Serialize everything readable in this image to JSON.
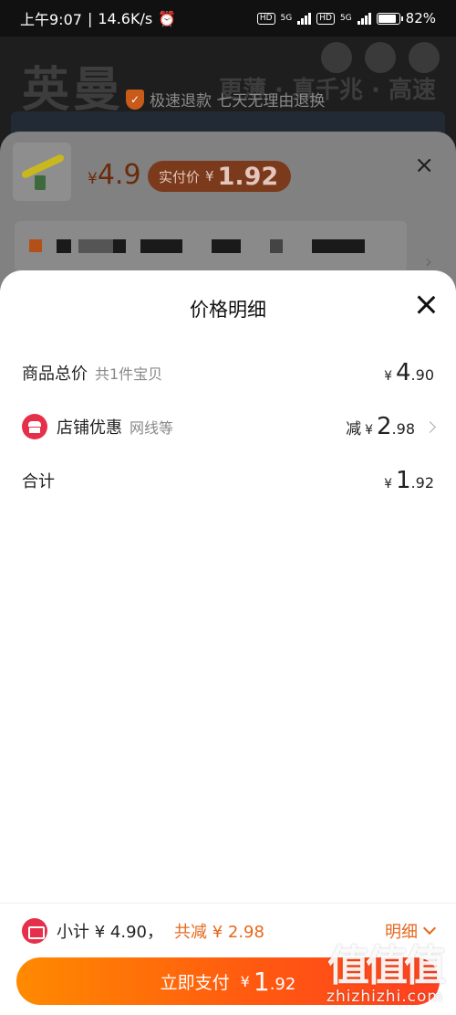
{
  "status_bar": {
    "time": "上午9:07",
    "speed": "14.6K/s",
    "network_1": "5G",
    "network_2": "5G",
    "battery": "82%"
  },
  "background": {
    "brand": "英曼",
    "slogan": "更薄 · 真千兆 · 高速",
    "refund_text": "极速退款 七天无理由退换"
  },
  "sku_panel": {
    "price_symbol": "¥",
    "price": "4.9",
    "actual_label": "实付价",
    "actual_symbol": "¥",
    "actual_price": "1.92",
    "close_icon": "×",
    "spec_text": "...(已打码)"
  },
  "price_detail": {
    "title": "价格明细",
    "rows": [
      {
        "label": "商品总价",
        "sub": "共1件宝贝",
        "prefix": "",
        "symbol": "¥",
        "integer": "4",
        "decimal": ".90"
      },
      {
        "label": "店铺优惠",
        "sub": "网线等",
        "prefix": "减",
        "symbol": "¥",
        "integer": "2",
        "decimal": ".98"
      },
      {
        "label": "合计",
        "sub": "",
        "prefix": "",
        "symbol": "¥",
        "integer": "1",
        "decimal": ".92"
      }
    ]
  },
  "bottom_bar": {
    "subtotal": "小计 ¥ 4.90，",
    "total_saved": "共减 ¥ 2.98",
    "detail_label": "明细",
    "pay_label": "立即支付",
    "pay_symbol": "¥",
    "pay_integer": "1",
    "pay_decimal": ".92"
  },
  "watermark": {
    "logo": "值值值",
    "site": "zhizhizhi.com"
  },
  "colors": {
    "accent": "#e5681e",
    "shop_icon": "#e6304b",
    "pay_gradient_start": "#ff8a00",
    "pay_gradient_end": "#ff4020"
  }
}
